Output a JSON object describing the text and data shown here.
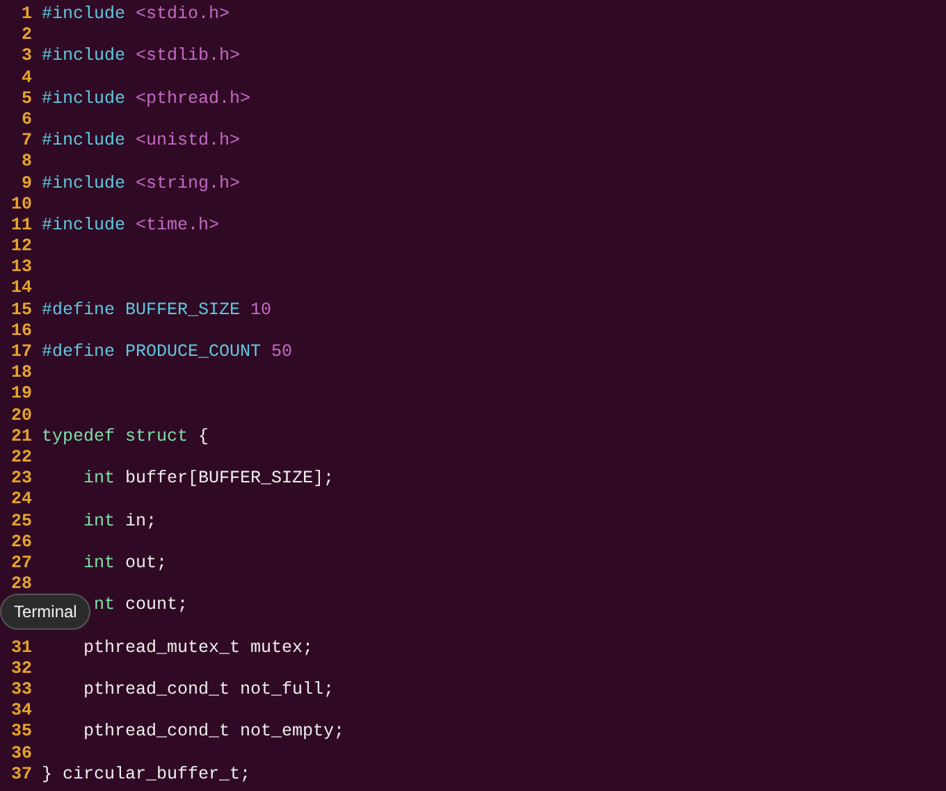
{
  "editor": {
    "lines": [
      {
        "number": "1",
        "tokens": [
          {
            "kind": "preproc",
            "text": "#include "
          },
          {
            "kind": "string",
            "text": "<stdio.h>"
          }
        ]
      },
      {
        "number": "2"
      },
      {
        "number": "3",
        "tokens": [
          {
            "kind": "preproc",
            "text": "#include "
          },
          {
            "kind": "string",
            "text": "<stdlib.h>"
          }
        ]
      },
      {
        "number": "4"
      },
      {
        "number": "5",
        "tokens": [
          {
            "kind": "preproc",
            "text": "#include "
          },
          {
            "kind": "string",
            "text": "<pthread.h>"
          }
        ]
      },
      {
        "number": "6"
      },
      {
        "number": "7",
        "tokens": [
          {
            "kind": "preproc",
            "text": "#include "
          },
          {
            "kind": "string",
            "text": "<unistd.h>"
          }
        ]
      },
      {
        "number": "8"
      },
      {
        "number": "9",
        "tokens": [
          {
            "kind": "preproc",
            "text": "#include "
          },
          {
            "kind": "string",
            "text": "<string.h>"
          }
        ]
      },
      {
        "number": "10"
      },
      {
        "number": "11",
        "tokens": [
          {
            "kind": "preproc",
            "text": "#include "
          },
          {
            "kind": "string",
            "text": "<time.h>"
          }
        ]
      },
      {
        "number": "12"
      },
      {
        "number": "13"
      },
      {
        "number": "14"
      },
      {
        "number": "15",
        "tokens": [
          {
            "kind": "preproc",
            "text": "#define BUFFER_SIZE "
          },
          {
            "kind": "number",
            "text": "10"
          }
        ]
      },
      {
        "number": "16"
      },
      {
        "number": "17",
        "tokens": [
          {
            "kind": "preproc",
            "text": "#define PRODUCE_COUNT "
          },
          {
            "kind": "number",
            "text": "50"
          }
        ]
      },
      {
        "number": "18"
      },
      {
        "number": "19"
      },
      {
        "number": "20"
      },
      {
        "number": "21",
        "tokens": [
          {
            "kind": "type",
            "text": "typedef struct "
          },
          {
            "kind": "plain",
            "text": "{"
          }
        ]
      },
      {
        "number": "22"
      },
      {
        "number": "23",
        "tokens": [
          {
            "kind": "type",
            "text": "    int "
          },
          {
            "kind": "plain",
            "text": "buffer[BUFFER_SIZE];"
          }
        ]
      },
      {
        "number": "24"
      },
      {
        "number": "25",
        "tokens": [
          {
            "kind": "type",
            "text": "    int "
          },
          {
            "kind": "plain",
            "text": "in;"
          }
        ]
      },
      {
        "number": "26"
      },
      {
        "number": "27",
        "tokens": [
          {
            "kind": "type",
            "text": "    int "
          },
          {
            "kind": "plain",
            "text": "out;"
          }
        ]
      },
      {
        "number": "28"
      },
      {
        "tokens": [
          {
            "kind": "type",
            "text": "     nt "
          },
          {
            "kind": "plain",
            "text": "count;"
          }
        ]
      },
      {
        "number": "31",
        "tokens": [
          {
            "kind": "plain",
            "text": "    pthread_mutex_t mutex;"
          }
        ]
      },
      {
        "number": "32"
      },
      {
        "number": "33",
        "tokens": [
          {
            "kind": "plain",
            "text": "    pthread_cond_t not_full;"
          }
        ]
      },
      {
        "number": "34"
      },
      {
        "number": "35",
        "tokens": [
          {
            "kind": "plain",
            "text": "    pthread_cond_t not_empty;"
          }
        ]
      },
      {
        "number": "36"
      },
      {
        "number": "37",
        "tokens": [
          {
            "kind": "plain",
            "text": "} circular_buffer_t;"
          }
        ]
      }
    ]
  },
  "tooltip": {
    "text": "Terminal"
  }
}
